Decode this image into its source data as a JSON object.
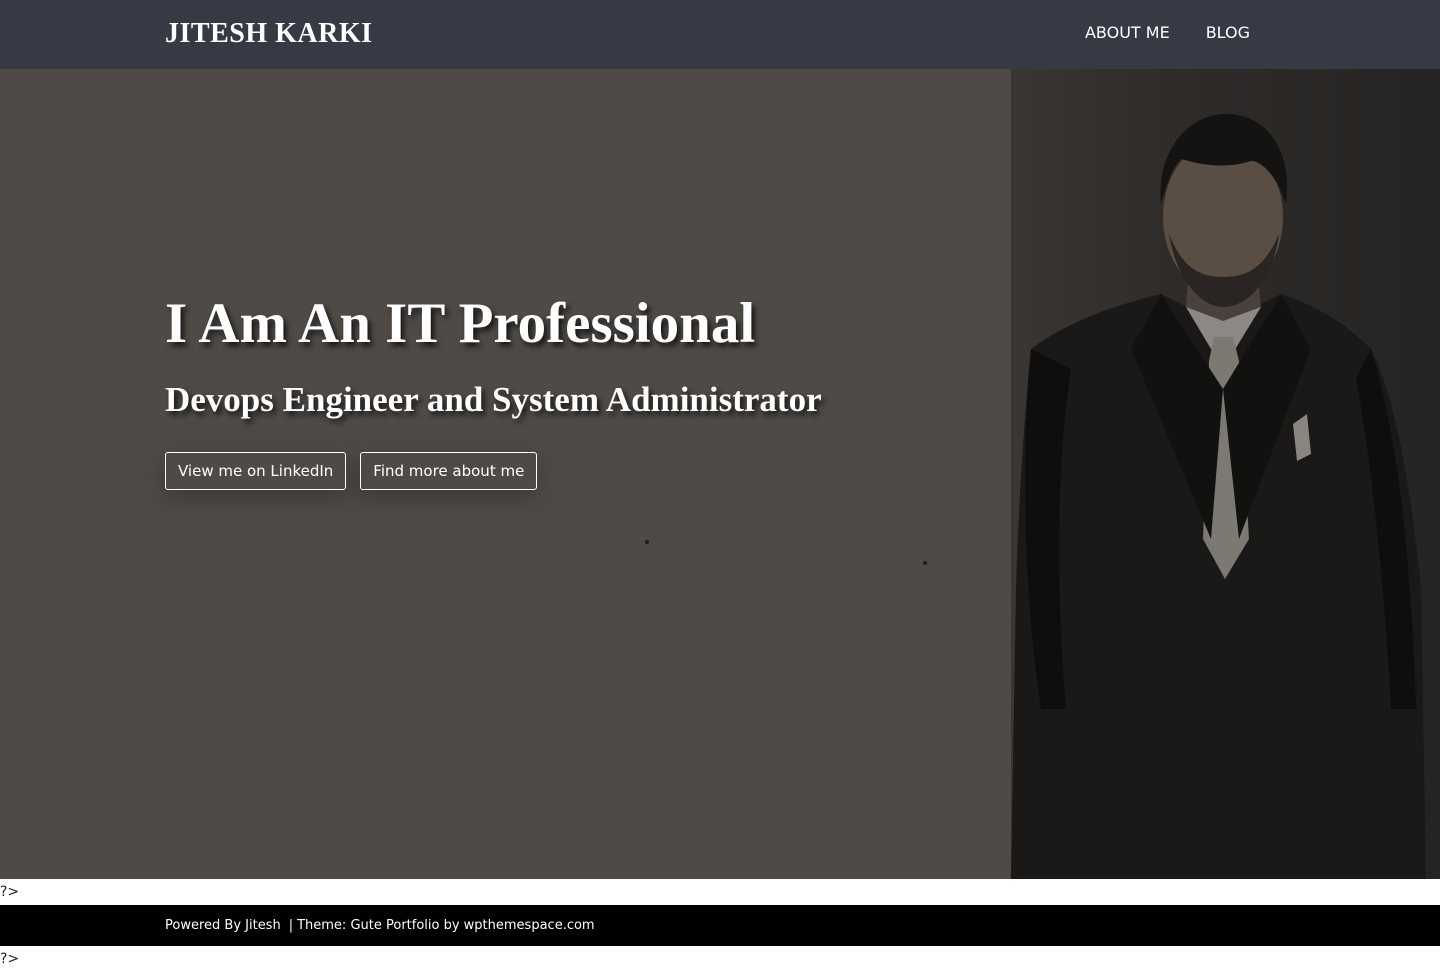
{
  "header": {
    "site_title": "JITESH KARKI",
    "nav": [
      {
        "label": "ABOUT ME"
      },
      {
        "label": "BLOG"
      }
    ],
    "background": "#353a44"
  },
  "hero": {
    "title": "I Am An IT Professional",
    "subtitle": "Devops Engineer and System Administrator",
    "buttons": [
      {
        "label": "View me on LinkedIn"
      },
      {
        "label": "Find more about me"
      }
    ],
    "background": "#4f4a46"
  },
  "stray_text": {
    "after_hero": "?>",
    "after_footer": "?>"
  },
  "footer": {
    "powered_by": "Powered By Jitesh",
    "separator": "|",
    "theme_credit": "Theme: Gute Portfolio by wpthemespace.com",
    "background": "#000000"
  }
}
